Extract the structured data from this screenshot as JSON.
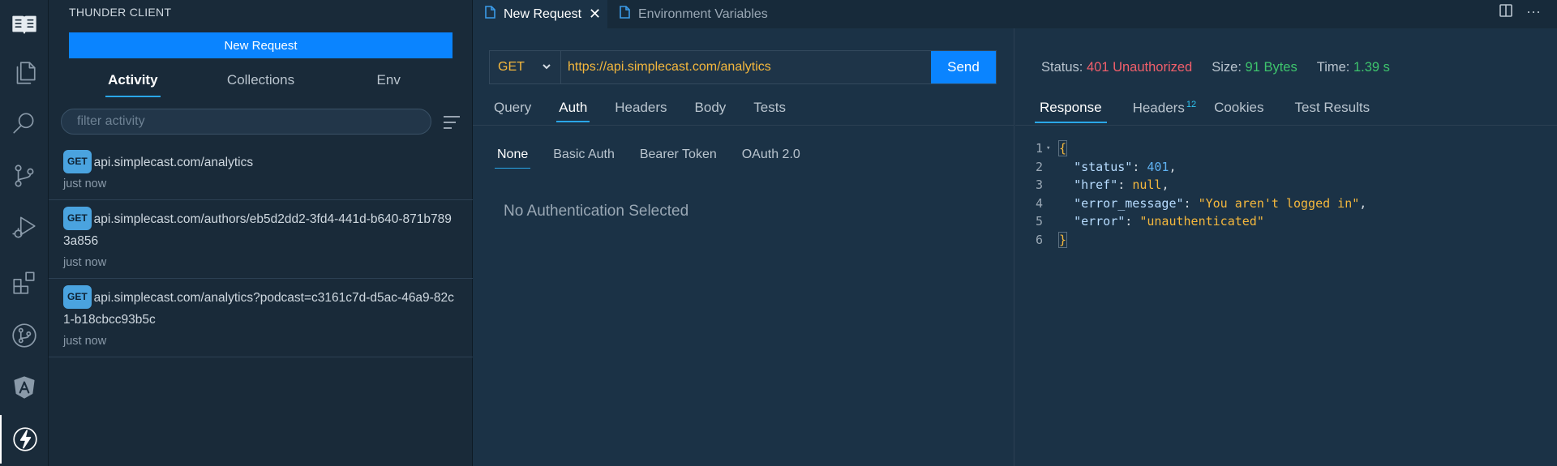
{
  "sidebar": {
    "title": "THUNDER CLIENT",
    "new_request_label": "New Request",
    "tabs": [
      "Activity",
      "Collections",
      "Env"
    ],
    "filter_placeholder": "filter activity",
    "activity": [
      {
        "method": "GET",
        "url": "api.simplecast.com/analytics",
        "time": "just now"
      },
      {
        "method": "GET",
        "url": "api.simplecast.com/authors/eb5d2dd2-3fd4-441d-b640-871b7893a856",
        "time": "just now"
      },
      {
        "method": "GET",
        "url": "api.simplecast.com/analytics?podcast=c3161c7d-d5ac-46a9-82c1-b18cbcc93b5c",
        "time": "just now"
      }
    ]
  },
  "editor_tabs": [
    {
      "label": "New Request",
      "close": "✕"
    },
    {
      "label": "Environment Variables"
    }
  ],
  "request": {
    "method": "GET",
    "url": "https://api.simplecast.com/analytics",
    "send_label": "Send",
    "tabs": [
      "Query",
      "Auth",
      "Headers",
      "Body",
      "Tests"
    ],
    "auth_tabs": [
      "None",
      "Basic Auth",
      "Bearer Token",
      "OAuth 2.0"
    ],
    "auth_message": "No Authentication Selected"
  },
  "response": {
    "status_label": "Status:",
    "status_value": "401 Unauthorized",
    "size_label": "Size:",
    "size_value": "91 Bytes",
    "time_label": "Time:",
    "time_value": "1.39 s",
    "tabs": [
      "Response",
      "Headers",
      "Cookies",
      "Test Results"
    ],
    "headers_count": "12",
    "line_numbers": [
      "1",
      "2",
      "3",
      "4",
      "5",
      "6"
    ],
    "body": {
      "open_brace": "{",
      "close_brace": "}",
      "l2_key": "\"status\"",
      "l2_val": "401",
      "l3_key": "\"href\"",
      "l3_val": "null",
      "l4_key": "\"error_message\"",
      "l4_val": "\"You aren't logged in\"",
      "l5_key": "\"error\"",
      "l5_val": "\"unauthenticated\""
    }
  },
  "colors": {
    "accent": "#0a84ff",
    "status_error": "#f25f6b",
    "status_ok": "#3ec46d",
    "method": "#f5b83d"
  }
}
